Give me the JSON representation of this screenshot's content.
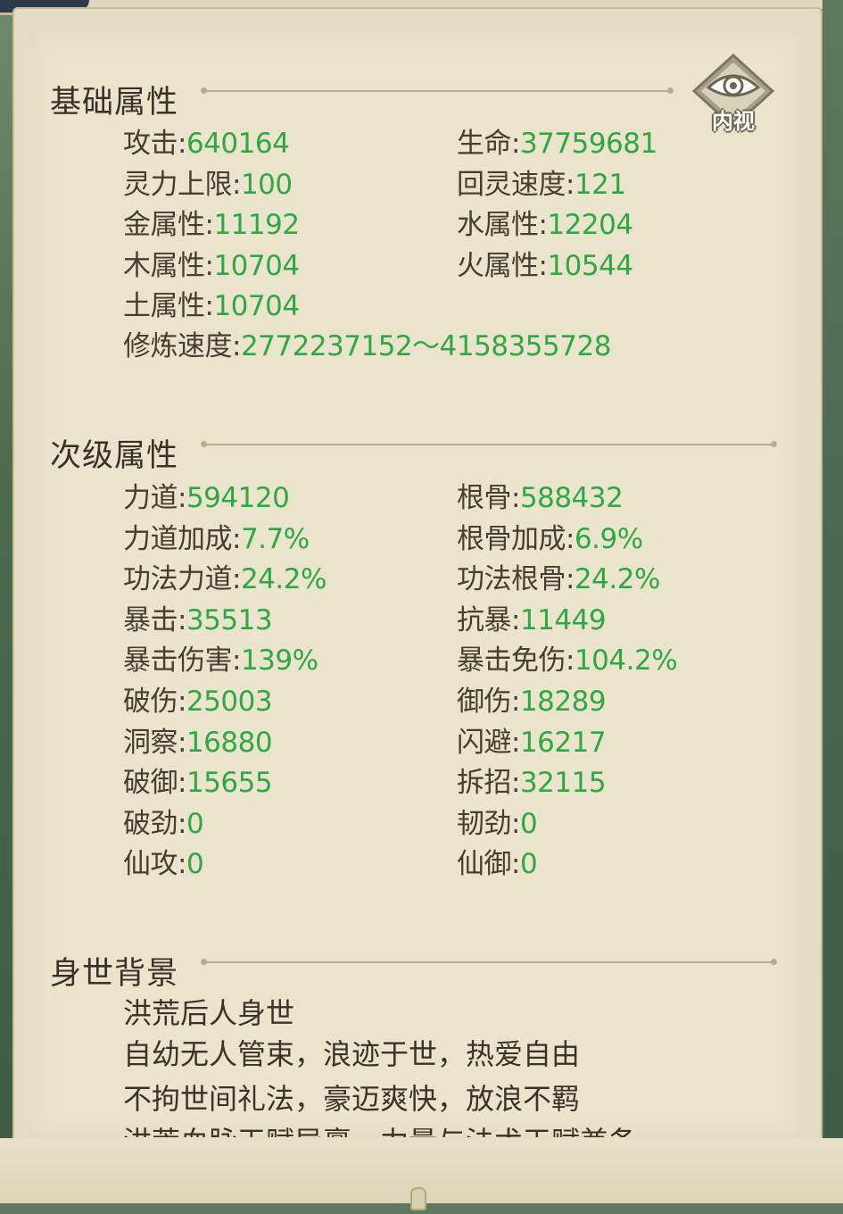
{
  "basic": {
    "title": "基础属性",
    "stats": [
      {
        "label": "攻击",
        "value": "640164"
      },
      {
        "label": "生命",
        "value": "37759681"
      },
      {
        "label": "灵力上限",
        "value": "100"
      },
      {
        "label": "回灵速度",
        "value": "121"
      },
      {
        "label": "金属性",
        "value": "11192"
      },
      {
        "label": "水属性",
        "value": "12204"
      },
      {
        "label": "木属性",
        "value": "10704"
      },
      {
        "label": "火属性",
        "value": "10544"
      },
      {
        "label": "土属性",
        "value": "10704"
      }
    ],
    "cultivation": {
      "label": "修炼速度",
      "value": "2772237152～4158355728"
    }
  },
  "inner_view": {
    "label": "内视"
  },
  "secondary": {
    "title": "次级属性",
    "stats": [
      {
        "label": "力道",
        "value": "594120"
      },
      {
        "label": "根骨",
        "value": "588432"
      },
      {
        "label": "力道加成",
        "value": "7.7%"
      },
      {
        "label": "根骨加成",
        "value": "6.9%"
      },
      {
        "label": "功法力道",
        "value": "24.2%"
      },
      {
        "label": "功法根骨",
        "value": "24.2%"
      },
      {
        "label": "暴击",
        "value": "35513"
      },
      {
        "label": "抗暴",
        "value": "11449"
      },
      {
        "label": "暴击伤害",
        "value": "139%"
      },
      {
        "label": "暴击免伤",
        "value": "104.2%"
      },
      {
        "label": "破伤",
        "value": "25003"
      },
      {
        "label": "御伤",
        "value": "18289"
      },
      {
        "label": "洞察",
        "value": "16880"
      },
      {
        "label": "闪避",
        "value": "16217"
      },
      {
        "label": "破御",
        "value": "15655"
      },
      {
        "label": "拆招",
        "value": "32115"
      },
      {
        "label": "破劲",
        "value": "0"
      },
      {
        "label": "韧劲",
        "value": "0"
      },
      {
        "label": "仙攻",
        "value": "0"
      },
      {
        "label": "仙御",
        "value": "0"
      }
    ]
  },
  "background": {
    "title": "身世背景",
    "lines": [
      "洪荒后人身世",
      "自幼无人管束，浪迹于世，热爱自由",
      "不拘世间礼法，豪迈爽快，放浪不羁",
      "洪荒血脉天赋异禀，力量与法术天赋兼备"
    ]
  },
  "colors": {
    "value_green": "#2fa743",
    "label_brown": "#4a3c2e",
    "panel_bg": "#ebe4cd"
  }
}
